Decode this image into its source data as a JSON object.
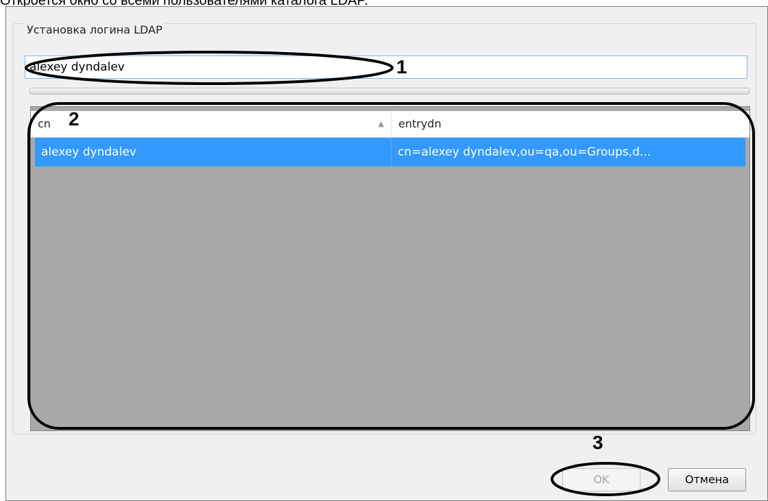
{
  "caption": "Откроется окно со всеми пользователями каталога LDAP.",
  "group_title": "Установка логина LDAP",
  "search": {
    "value": "alexey dyndalev"
  },
  "grid": {
    "columns": [
      "cn",
      "entrydn"
    ],
    "rows": [
      {
        "cn": "alexey dyndalev",
        "entrydn": "cn=alexey dyndalev,ou=qa,ou=Groups,d..."
      }
    ],
    "sort_arrow": "▲"
  },
  "buttons": {
    "ok": "OK",
    "cancel": "Отмена"
  },
  "markers": {
    "m1": "1",
    "m2": "2",
    "m3": "3"
  }
}
